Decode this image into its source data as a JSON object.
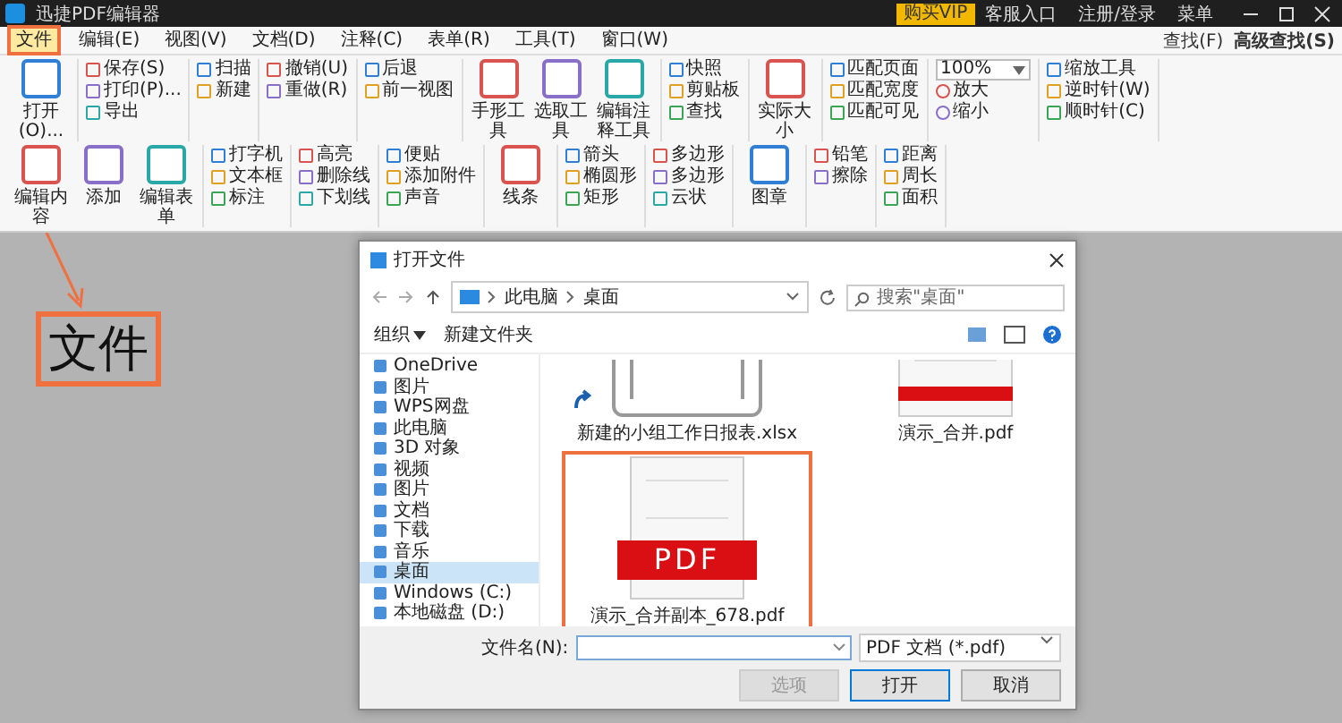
{
  "app": {
    "title": "迅捷PDF编辑器",
    "actions": [
      {
        "label": "购买VIP",
        "kind": "vip"
      },
      {
        "label": "客服入口",
        "kind": "link"
      },
      {
        "label": "注册/登录",
        "kind": "link"
      },
      {
        "label": "菜单",
        "kind": "link"
      }
    ]
  },
  "menu": [
    {
      "label": "文件",
      "selected": true
    },
    {
      "label": "编辑(E)",
      "selected": false
    },
    {
      "label": "视图(V)",
      "selected": false
    },
    {
      "label": "文档(D)",
      "selected": false
    },
    {
      "label": "注释(C)",
      "selected": false
    },
    {
      "label": "表单(R)",
      "selected": false
    },
    {
      "label": "工具(T)",
      "selected": false
    },
    {
      "label": "窗口(W)",
      "selected": false
    }
  ],
  "find": [
    {
      "label": "查找(F)",
      "emphasized": false
    },
    {
      "label": "高级查找(S)",
      "emphasized": true
    }
  ],
  "ribbon": [
    {
      "kind": "large",
      "items": [
        "打开(O)..."
      ]
    },
    {
      "kind": "stack",
      "items": [
        "保存(S)",
        "打印(P)...",
        "导出"
      ]
    },
    {
      "kind": "stack",
      "items": [
        "扫描",
        "新建"
      ]
    },
    {
      "kind": "stack",
      "items": [
        "撤销(U)",
        "重做(R)"
      ]
    },
    {
      "kind": "stack",
      "items": [
        "后退",
        "前一视图"
      ]
    },
    {
      "kind": "large",
      "items": [
        "手形工具",
        "选取工具",
        "编辑注释工具"
      ]
    },
    {
      "kind": "stack",
      "items": [
        "快照",
        "剪贴板",
        "查找"
      ]
    },
    {
      "kind": "large",
      "items": [
        "实际大小"
      ]
    },
    {
      "kind": "stack",
      "items": [
        "匹配页面",
        "匹配宽度",
        "匹配可见"
      ]
    },
    {
      "kind": "zoom",
      "value": "100%",
      "items": [
        "放大",
        "缩小"
      ]
    },
    {
      "kind": "stack",
      "items": [
        "缩放工具",
        "逆时针(W)",
        "顺时针(C)"
      ]
    },
    {
      "kind": "large",
      "items": [
        "编辑内容",
        "添加",
        "编辑表单"
      ]
    },
    {
      "kind": "stack",
      "items": [
        "打字机",
        "文本框",
        "标注"
      ]
    },
    {
      "kind": "stack",
      "items": [
        "高亮",
        "删除线",
        "下划线"
      ]
    },
    {
      "kind": "stack",
      "items": [
        "便贴",
        "添加附件",
        "声音"
      ]
    },
    {
      "kind": "large",
      "items": [
        "线条"
      ]
    },
    {
      "kind": "stack",
      "items": [
        "箭头",
        "椭圆形",
        "矩形"
      ]
    },
    {
      "kind": "stack",
      "items": [
        "多边形",
        "多边形",
        "云状"
      ]
    },
    {
      "kind": "large",
      "items": [
        "图章"
      ]
    },
    {
      "kind": "stack",
      "items": [
        "铅笔",
        "擦除"
      ]
    },
    {
      "kind": "stack",
      "items": [
        "距离",
        "周长",
        "面积"
      ]
    }
  ],
  "callout": "文件",
  "dialog": {
    "title": "打开文件",
    "path": [
      "此电脑",
      "桌面"
    ],
    "search": {
      "placeholder": "搜索\"桌面\""
    },
    "toolbar": [
      "组织",
      "新建文件夹"
    ],
    "sidebar": [
      {
        "label": "OneDrive",
        "selected": false
      },
      {
        "label": "图片",
        "selected": false
      },
      {
        "label": "WPS网盘",
        "selected": false
      },
      {
        "label": "此电脑",
        "selected": false
      },
      {
        "label": "3D 对象",
        "selected": false
      },
      {
        "label": "视频",
        "selected": false
      },
      {
        "label": "图片",
        "selected": false
      },
      {
        "label": "文档",
        "selected": false
      },
      {
        "label": "下载",
        "selected": false
      },
      {
        "label": "音乐",
        "selected": false
      },
      {
        "label": "桌面",
        "selected": true
      },
      {
        "label": "Windows (C:)",
        "selected": false
      },
      {
        "label": "本地磁盘 (D:)",
        "selected": false
      }
    ],
    "files": [
      {
        "name": "新建的小组工作日报表.xlsx",
        "kind": "sheet",
        "shortcut": true,
        "selected": false
      },
      {
        "name": "演示_合并.pdf",
        "kind": "pdf",
        "shortcut": false,
        "selected": false
      },
      {
        "name": "演示_合并副本_678.pdf",
        "kind": "pdf",
        "badge": "PDF",
        "shortcut": false,
        "selected": true
      }
    ],
    "filename_label": "文件名(N):",
    "filetype": "PDF 文档 (*.pdf)",
    "buttons": [
      {
        "label": "选项",
        "disabled": true
      },
      {
        "label": "打开",
        "disabled": false
      },
      {
        "label": "取消",
        "disabled": false
      }
    ]
  }
}
